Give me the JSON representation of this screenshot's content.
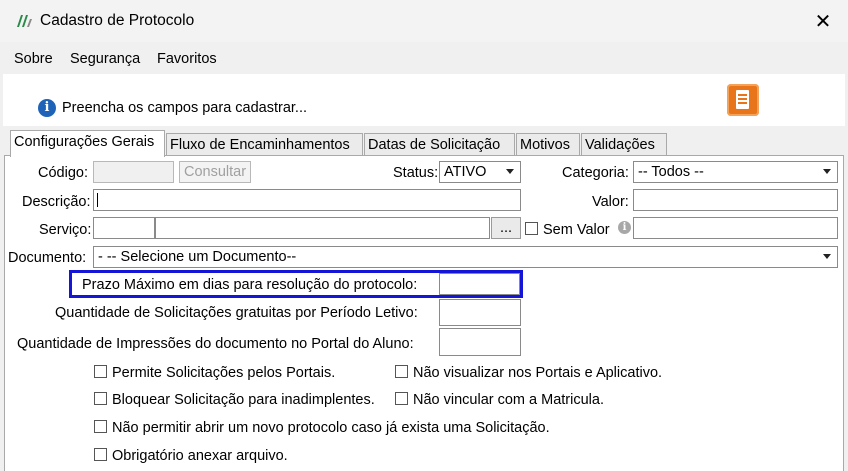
{
  "window": {
    "title": "Cadastro de Protocolo",
    "close_glyph": "✕"
  },
  "menu": [
    {
      "label": "Sobre"
    },
    {
      "label": "Segurança"
    },
    {
      "label": "Favoritos"
    }
  ],
  "info": {
    "text": "Preencha os campos para cadastrar...",
    "icon_glyph": "i"
  },
  "tabs": [
    {
      "label": "Configurações Gerais",
      "active": true
    },
    {
      "label": "Fluxo de Encaminhamentos"
    },
    {
      "label": "Datas de Solicitação"
    },
    {
      "label": "Motivos"
    },
    {
      "label": "Validações"
    }
  ],
  "form": {
    "codigo_label": "Código:",
    "consultar_label": "Consultar",
    "status_label": "Status:",
    "status_value": "ATIVO",
    "categoria_label": "Categoria:",
    "categoria_value": "-- Todos --",
    "descricao_label": "Descrição:",
    "valor_label": "Valor:",
    "servico_label": "Serviço:",
    "ellipsis_label": "...",
    "sem_valor_label": "Sem Valor",
    "documento_label": "Documento:",
    "documento_value": "- -- Selecione um Documento--",
    "prazo_label": "Prazo Máximo em dias para resolução do protocolo:",
    "quantidade_solicitacoes_label": "Quantidade de Solicitações gratuitas por Período Letivo:",
    "quantidade_impressoes_label": "Quantidade de Impressões do documento no Portal do Aluno:"
  },
  "checkboxes": {
    "permite_portais": "Permite Solicitações pelos Portais.",
    "nao_visualizar": "Não visualizar nos Portais e Aplicativo.",
    "bloquear_inadimplentes": "Bloquear Solicitação para inadimplentes.",
    "nao_vincular": "Não vincular com a Matricula.",
    "nao_permitir_novo": "Não permitir abrir um novo protocolo caso já exista uma Solicitação.",
    "obrigatorio_anexar": "Obrigatório anexar arquivo."
  },
  "colors": {
    "highlight": "#1515d8",
    "info_icon": "#1e63b8",
    "report_button": "#e8751a"
  }
}
